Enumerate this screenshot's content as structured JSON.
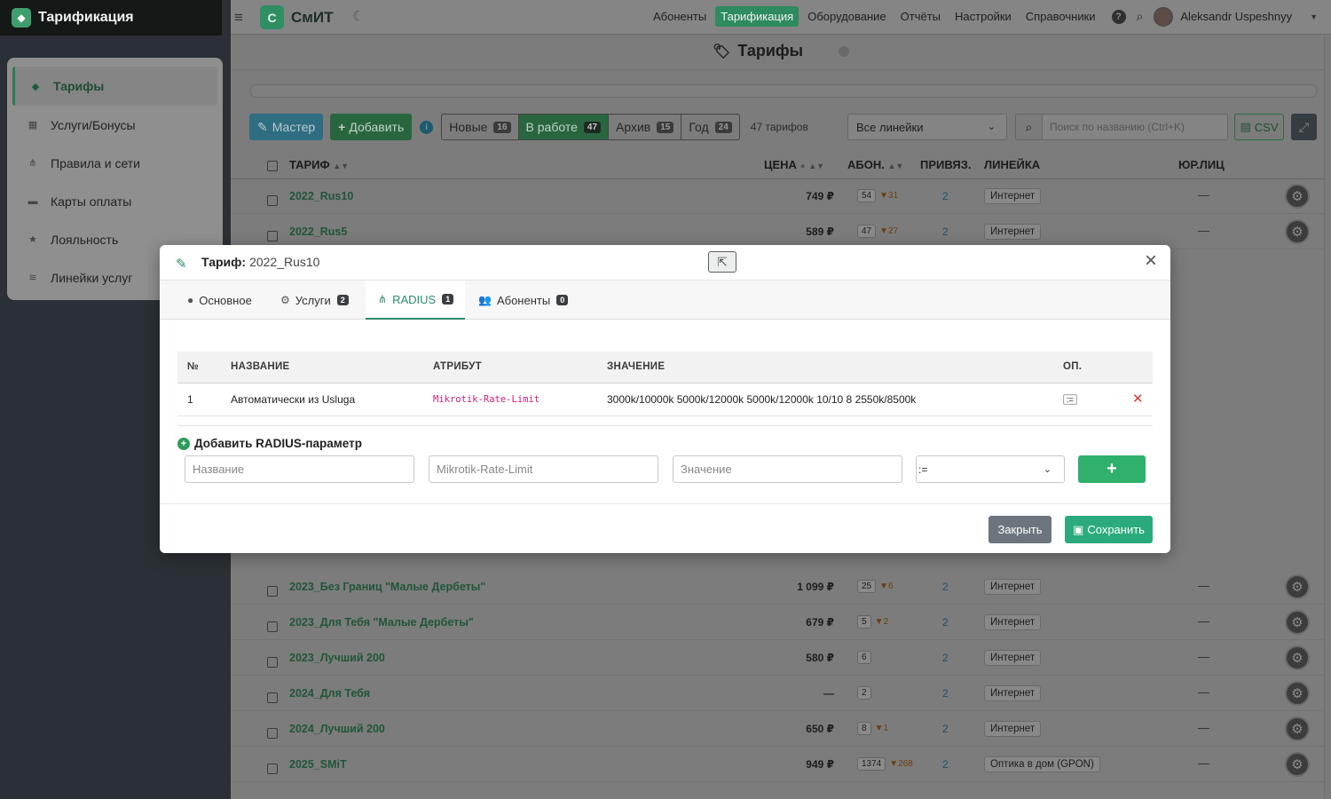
{
  "sidebar": {
    "title": "Тарификация",
    "items": [
      {
        "label": "Тарифы",
        "icon": "tag-icon",
        "active": true
      },
      {
        "label": "Услуги/Бонусы",
        "icon": "gift-icon"
      },
      {
        "label": "Правила и сети",
        "icon": "sitemap-icon"
      },
      {
        "label": "Карты оплаты",
        "icon": "credit-card-icon"
      },
      {
        "label": "Лояльность",
        "icon": "star-icon"
      },
      {
        "label": "Линейки услуг",
        "icon": "layers-icon"
      }
    ]
  },
  "topbar": {
    "brand": "СмИТ",
    "brand_logo": "С",
    "nav": [
      "Абоненты",
      "Тарификация",
      "Оборудование",
      "Отчёты",
      "Настройки",
      "Справочники"
    ],
    "active_nav": "Тарификация",
    "user": "Aleksandr Uspeshnyy"
  },
  "page": {
    "title": "Тарифы"
  },
  "toolbar": {
    "master": "Мастер",
    "add": "Добавить",
    "segments": [
      {
        "label": "Новые",
        "count": "16"
      },
      {
        "label": "В работе",
        "count": "47",
        "active": true
      },
      {
        "label": "Архив",
        "count": "15"
      },
      {
        "label": "Год",
        "count": "24"
      }
    ],
    "total": "47 тарифов",
    "lines_select": "Все линейки",
    "search_placeholder": "Поиск по названию (Ctrl+K)",
    "csv": "CSV"
  },
  "table": {
    "headers": {
      "tariff": "ТАРИФ",
      "price": "ЦЕНА",
      "abon": "АБОН.",
      "bound": "ПРИВЯЗ.",
      "line": "ЛИНЕЙКА",
      "legal": "ЮР.ЛИЦ"
    },
    "rows": [
      {
        "name": "2022_Rus10",
        "price": "749 ₽",
        "abon": "54",
        "delta": "▼31",
        "bound": "2",
        "line": "Интернет",
        "legal": "—"
      },
      {
        "name": "2022_Rus5",
        "price": "589 ₽",
        "abon": "47",
        "delta": "▼27",
        "bound": "2",
        "line": "Интернет",
        "legal": "—"
      },
      {
        "name": "2023_Без Границ \"Малые Дербеты\"",
        "price": "1 099 ₽",
        "abon": "25",
        "delta": "▼6",
        "bound": "2",
        "line": "Интернет",
        "legal": "—"
      },
      {
        "name": "2023_Для Тебя \"Малые Дербеты\"",
        "price": "679 ₽",
        "abon": "5",
        "delta": "▼2",
        "bound": "2",
        "line": "Интернет",
        "legal": "—"
      },
      {
        "name": "2023_Лучший 200",
        "price": "580 ₽",
        "abon": "6",
        "delta": "",
        "bound": "2",
        "line": "Интернет",
        "legal": "—"
      },
      {
        "name": "2024_Для Тебя",
        "price": "—",
        "abon": "2",
        "delta": "",
        "bound": "2",
        "line": "Интернет",
        "legal": "—"
      },
      {
        "name": "2024_Лучший 200",
        "price": "650 ₽",
        "abon": "8",
        "delta": "▼1",
        "bound": "2",
        "line": "Интернет",
        "legal": "—"
      },
      {
        "name": "2025_SMiT",
        "price": "949 ₽",
        "abon": "1374",
        "delta": "▼268",
        "bound": "2",
        "line": "Оптика в дом (GPON)",
        "legal": "—"
      }
    ]
  },
  "modal": {
    "label": "Тариф:",
    "tariff": "2022_Rus10",
    "tabs": [
      {
        "label": "Основное",
        "icon": "info-icon",
        "count": ""
      },
      {
        "label": "Услуги",
        "icon": "cogs-icon",
        "count": "2"
      },
      {
        "label": "RADIUS",
        "icon": "network-icon",
        "count": "1",
        "active": true
      },
      {
        "label": "Абоненты",
        "icon": "users-icon",
        "count": "0"
      }
    ],
    "radius_headers": {
      "num": "№",
      "name": "НАЗВАНИЕ",
      "attr": "АТРИБУТ",
      "value": "ЗНАЧЕНИЕ",
      "op": "ОП."
    },
    "radius_rows": [
      {
        "num": "1",
        "name": "Автоматически из Usluga",
        "attr": "Mikrotik-Rate-Limit",
        "value": "3000k/10000k 5000k/12000k 5000k/12000k 10/10 8 2550k/8500k",
        "op": ":="
      }
    ],
    "add_label": "Добавить RADIUS-параметр",
    "form": {
      "name_placeholder": "Название",
      "attr_placeholder": "Mikrotik-Rate-Limit",
      "value_placeholder": "Значение",
      "op_selected": ":="
    },
    "close_label": "Закрыть",
    "save_label": "Сохранить"
  }
}
